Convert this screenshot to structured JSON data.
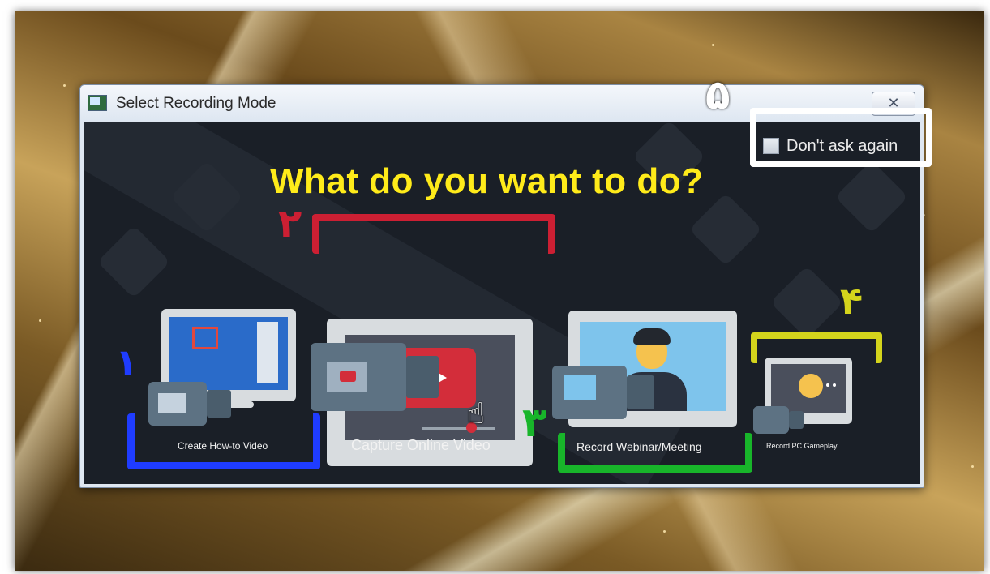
{
  "window": {
    "title": "Select Recording Mode",
    "close_symbol": "✕"
  },
  "content": {
    "headline": "What do you want to do?",
    "dont_ask_label": "Don't ask again"
  },
  "options": [
    {
      "label": "Create How-to Video",
      "annotation": "۱",
      "color": "#1f3cff"
    },
    {
      "label": "Capture Online Video",
      "annotation": "۲",
      "color": "#cc1f33"
    },
    {
      "label": "Record Webinar/Meeting",
      "annotation": "۳",
      "color": "#18b52a"
    },
    {
      "label": "Record PC Gameplay",
      "annotation": "۴",
      "color": "#d4d41c"
    }
  ],
  "annotation_five": "۵",
  "colors": {
    "headline": "#ffeb1a",
    "content_bg": "#1a1f27",
    "play_red": "#d32d3a"
  },
  "icons": [
    "app-icon",
    "close-icon",
    "checkbox",
    "play-icon",
    "hand-cursor-icon",
    "pacman-icon",
    "presenter-icon"
  ]
}
